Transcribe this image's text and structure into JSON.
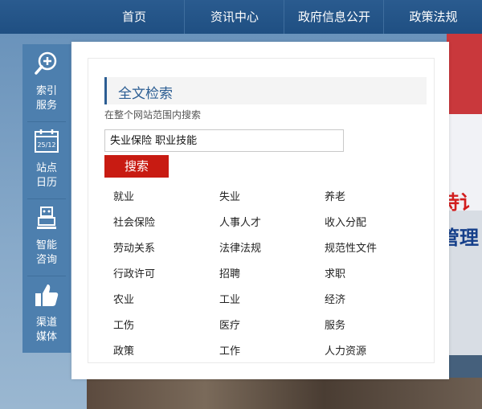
{
  "nav": {
    "items": [
      "首页",
      "资讯中心",
      "政府信息公开",
      "政策法规"
    ]
  },
  "sidebar": {
    "items": [
      {
        "label1": "索引",
        "label2": "服务",
        "icon": "search-plus-icon"
      },
      {
        "label1": "站点",
        "label2": "日历",
        "icon": "calendar-icon",
        "date": "25/12"
      },
      {
        "label1": "智能",
        "label2": "咨询",
        "icon": "robot-icon"
      },
      {
        "label1": "渠道",
        "label2": "媒体",
        "icon": "thumbs-up-icon"
      }
    ]
  },
  "search": {
    "title": "全文检索",
    "subtitle": "在整个网站范围内搜索",
    "query": "失业保险 职业技能",
    "button": "搜索"
  },
  "keywords": [
    [
      "就业",
      "失业",
      "养老"
    ],
    [
      "社会保险",
      "人事人才",
      "收入分配"
    ],
    [
      "劳动关系",
      "法律法规",
      "规范性文件"
    ],
    [
      "行政许可",
      "招聘",
      "求职"
    ],
    [
      "农业",
      "工业",
      "经济"
    ],
    [
      "工伤",
      "医疗",
      "服务"
    ],
    [
      "政策",
      "工作",
      "人力资源"
    ]
  ],
  "background": {
    "headline_fragment1": "持讠",
    "headline_fragment2": "管理"
  },
  "colors": {
    "nav_bg": "#1f4f82",
    "sidebar_bg": "#4d7fae",
    "title_accent": "#2c5e93",
    "button_red": "#c81b12"
  }
}
